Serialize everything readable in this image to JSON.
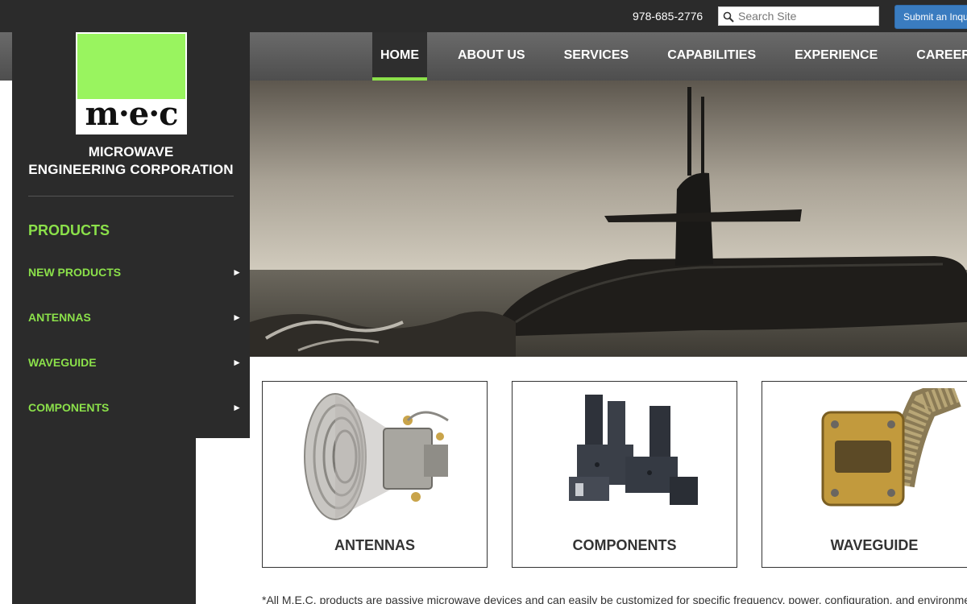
{
  "topbar": {
    "phone": "978-685-2776",
    "search_placeholder": "Search Site",
    "inquiry_label": "Submit an Inquiry"
  },
  "nav": {
    "items": [
      {
        "label": "HOME",
        "active": true
      },
      {
        "label": "ABOUT US"
      },
      {
        "label": "SERVICES"
      },
      {
        "label": "CAPABILITIES"
      },
      {
        "label": "EXPERIENCE"
      },
      {
        "label": "CAREERS"
      }
    ]
  },
  "logo": {
    "mark": "m·e·c",
    "line1": "MICROWAVE",
    "line2": "ENGINEERING CORPORATION",
    "accent_color": "#99f45f"
  },
  "sidebar": {
    "title": "PRODUCTS",
    "items": [
      {
        "label": "NEW PRODUCTS",
        "arrow": "►"
      },
      {
        "label": "ANTENNAS",
        "arrow": "►"
      },
      {
        "label": "WAVEGUIDE",
        "arrow": "►"
      },
      {
        "label": "COMPONENTS",
        "arrow": "►"
      }
    ]
  },
  "cards": [
    {
      "label": "ANTENNAS",
      "icon": "antenna-horn-icon"
    },
    {
      "label": "COMPONENTS",
      "icon": "waveguide-components-icon"
    },
    {
      "label": "WAVEGUIDE",
      "icon": "flexible-waveguide-icon"
    }
  ],
  "footnote": "*All M.E.C. products are passive microwave devices and can easily be customized for specific frequency, power, configuration, and environmental",
  "colors": {
    "brand_green": "#8be04a",
    "dark": "#2b2b2b",
    "button_blue": "#3a7cc0"
  }
}
